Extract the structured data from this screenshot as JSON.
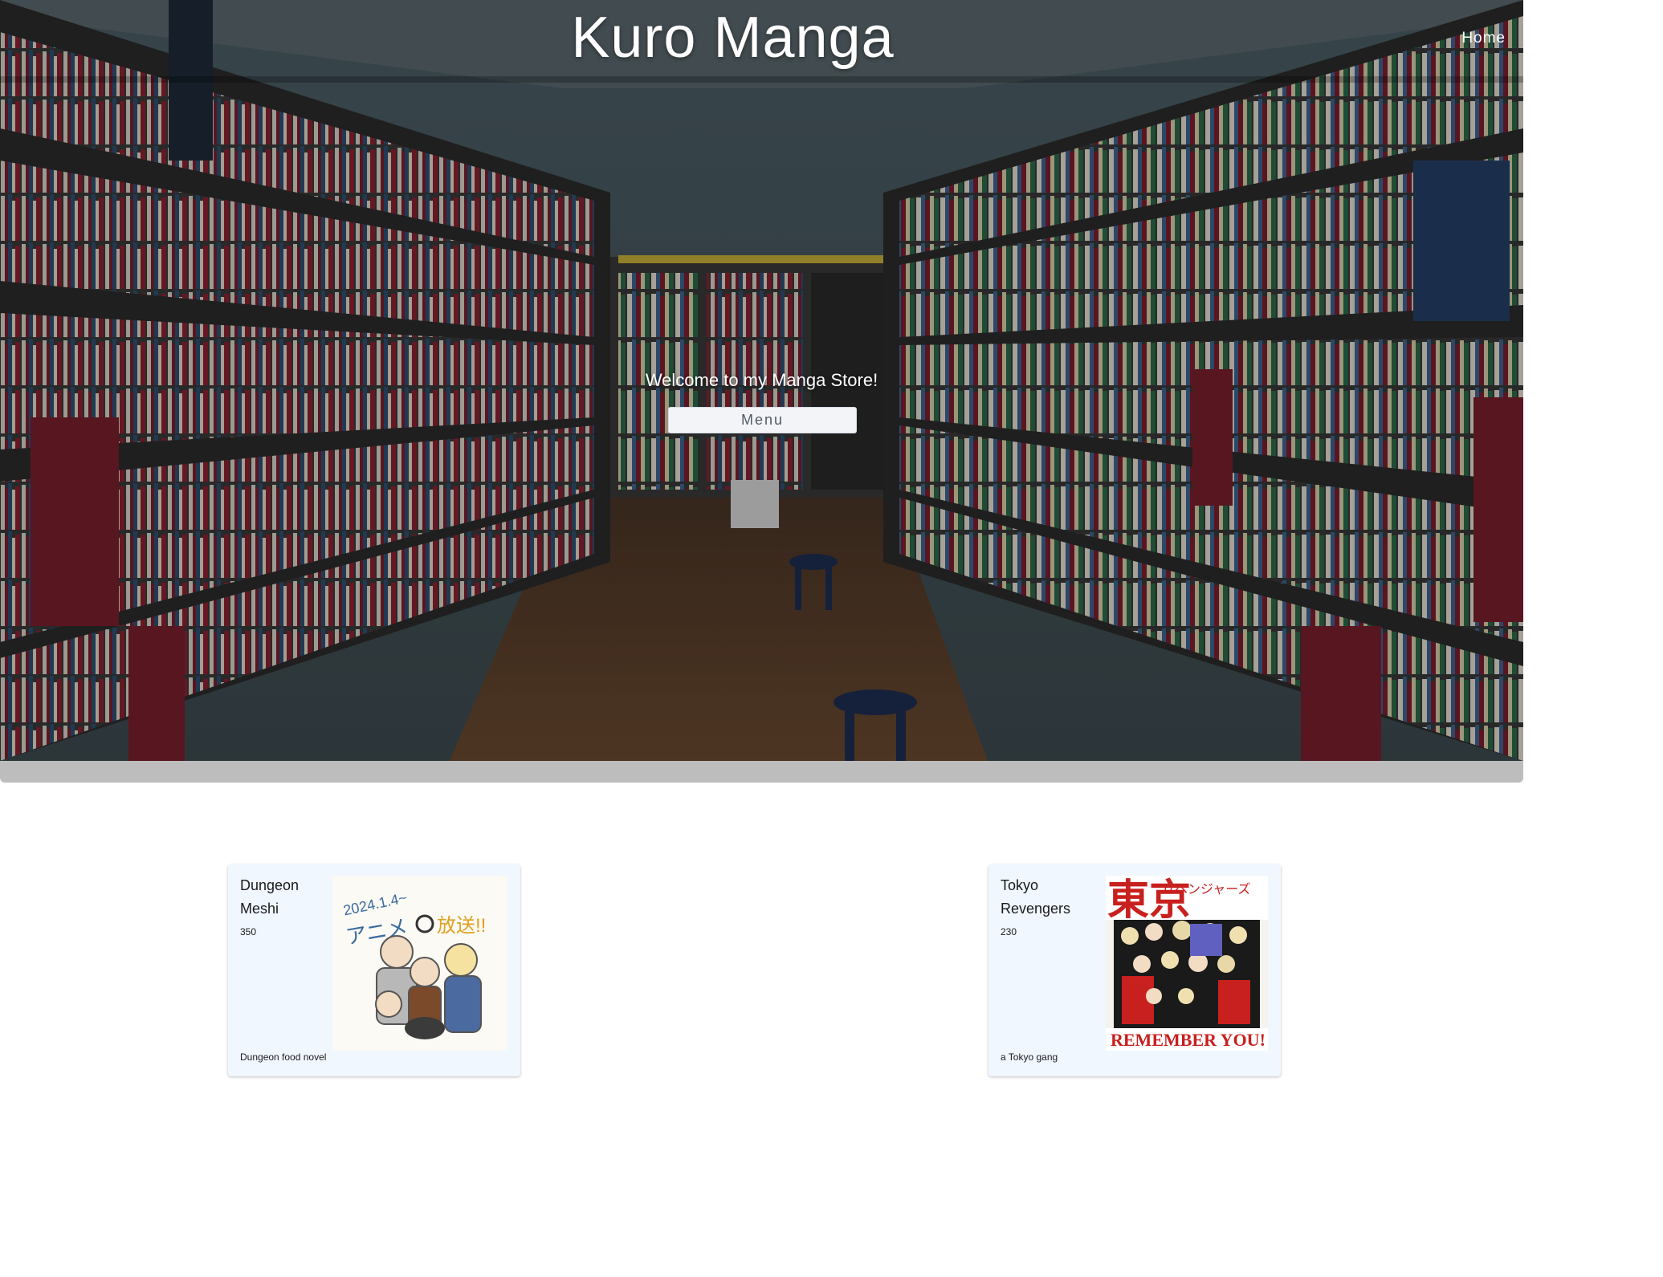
{
  "header": {
    "title": "Kuro Manga",
    "nav_home": "Home"
  },
  "hero": {
    "welcome": "Welcome to my Manga Store!",
    "menu_button": "Menu"
  },
  "products": [
    {
      "title": "Dungeon Meshi",
      "price": "350",
      "description": "Dungeon food novel",
      "cover_icon": "dungeon-meshi-cover"
    },
    {
      "title": "Tokyo Revengers",
      "price": "230",
      "description": "a Tokyo gang",
      "cover_icon": "tokyo-revengers-cover"
    }
  ],
  "colors": {
    "card_bg": "#f0f7ff",
    "shelf_red": "#7a1f2e",
    "hero_shadow": "#bdbdbd"
  }
}
